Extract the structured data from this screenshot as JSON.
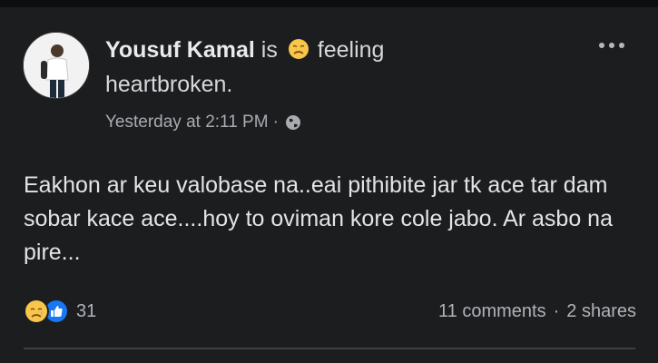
{
  "post": {
    "author": "Yousuf Kamal",
    "is_word": "is",
    "feeling_word": "feeling",
    "feeling_status": "heartbroken.",
    "feeling_icon": "sad-face-emoji",
    "timestamp": "Yesterday at 2:11 PM",
    "meta_separator": "·",
    "privacy_icon": "globe-icon",
    "more_icon": "more-options-icon",
    "body": "Eakhon ar keu valobase na..eai pithibite jar tk ace tar dam sobar kace ace....hoy to oviman kore cole jabo. Ar asbo na pire...",
    "reactions": {
      "icons": [
        "sad-reaction-icon",
        "like-reaction-icon"
      ],
      "count": "31"
    },
    "stats": {
      "comments": "11 comments",
      "separator": "·",
      "shares": "2 shares"
    }
  },
  "colors": {
    "background": "#1c1d1f",
    "text_primary": "#e9eaed",
    "text_secondary": "#a8abb0",
    "like_blue": "#1877f2",
    "sad_yellow": "#f7c64a"
  }
}
